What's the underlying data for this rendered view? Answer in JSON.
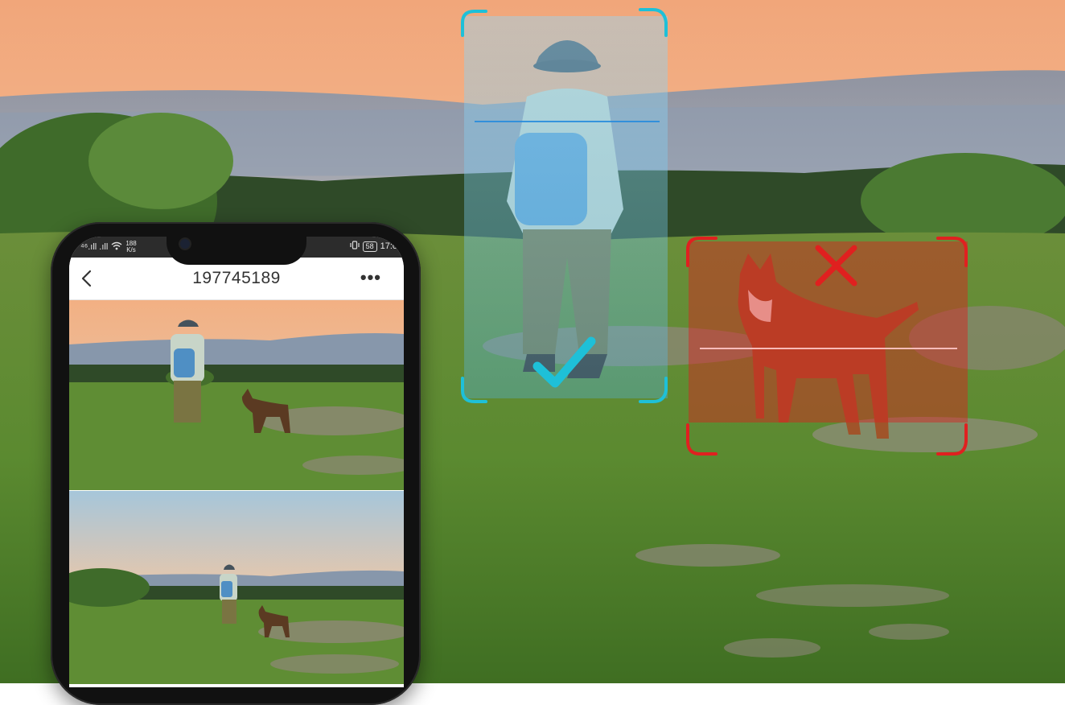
{
  "scene": {
    "description_icons": {
      "person_status": "checkmark-icon",
      "dog_status": "cross-icon"
    },
    "colors": {
      "person_frame": "#1ec0d8",
      "dog_frame": "#e02020",
      "check": "#1ec0d8",
      "cross": "#e0201f"
    }
  },
  "phone": {
    "status_bar": {
      "signal": "⁴⁶.ıll .ıll",
      "speed_value": "188",
      "speed_unit": "K/s",
      "battery": "58",
      "time": "17:0"
    },
    "header": {
      "back_icon": "chevron-left-icon",
      "title": "197745189",
      "more_label": "•••"
    },
    "recordings": [
      {
        "name": "recording-thumbnail-1"
      },
      {
        "name": "recording-thumbnail-2"
      }
    ]
  }
}
